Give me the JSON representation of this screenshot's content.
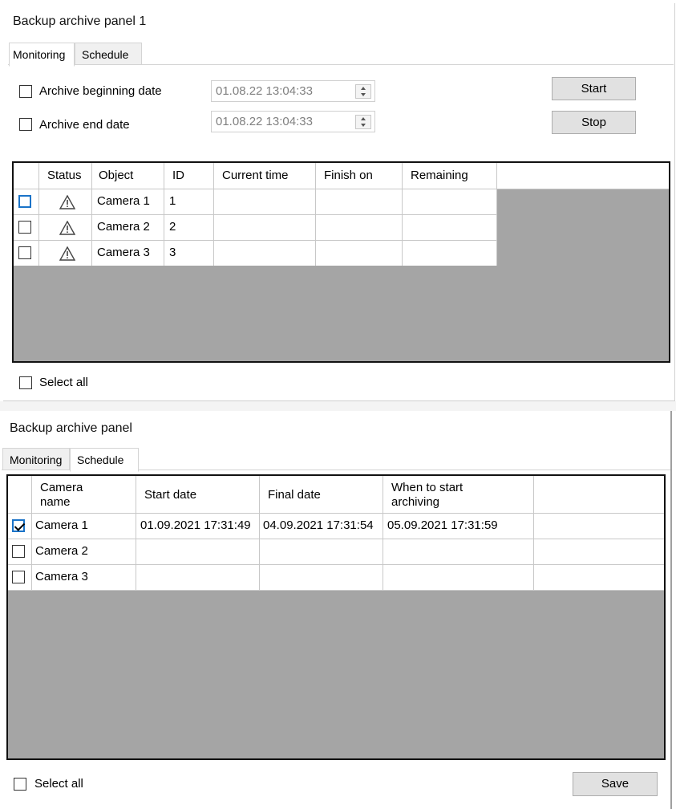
{
  "panel1": {
    "title": "Backup archive panel 1",
    "tabs": [
      "Monitoring",
      "Schedule"
    ],
    "begin_label": "Archive beginning date",
    "begin_value": "01.08.22 13:04:33",
    "end_label": "Archive end date",
    "end_value": "01.08.22 13:04:33",
    "start_label": "Start",
    "stop_label": "Stop",
    "columns": [
      "Status",
      "Object",
      "ID",
      "Current time",
      "Finish on",
      "Remaining"
    ],
    "rows": [
      {
        "object": "Camera 1",
        "id": "1",
        "status": "warning-icon"
      },
      {
        "object": "Camera 2",
        "id": "2",
        "status": "warning-icon"
      },
      {
        "object": "Camera 3",
        "id": "3",
        "status": "warning-icon"
      }
    ],
    "select_all": "Select all"
  },
  "panel2": {
    "title": "Backup archive panel",
    "tabs": [
      "Monitoring",
      "Schedule"
    ],
    "columns": [
      "Camera name",
      "Start date",
      "Final date",
      "When to start archiving"
    ],
    "rows": [
      {
        "name": "Camera 1",
        "start": "01.09.2021 17:31:49",
        "final": "04.09.2021 17:31:54",
        "when": "05.09.2021 17:31:59",
        "checked": true
      },
      {
        "name": "Camera 2",
        "start": "",
        "final": "",
        "when": "",
        "checked": false
      },
      {
        "name": "Camera 3",
        "start": "",
        "final": "",
        "when": "",
        "checked": false
      }
    ],
    "select_all": "Select all",
    "save_label": "Save"
  },
  "colors": {
    "grid_empty": "#a5a5a5",
    "button_bg": "#e1e1e1",
    "focus_blue": "#1a73c8"
  }
}
